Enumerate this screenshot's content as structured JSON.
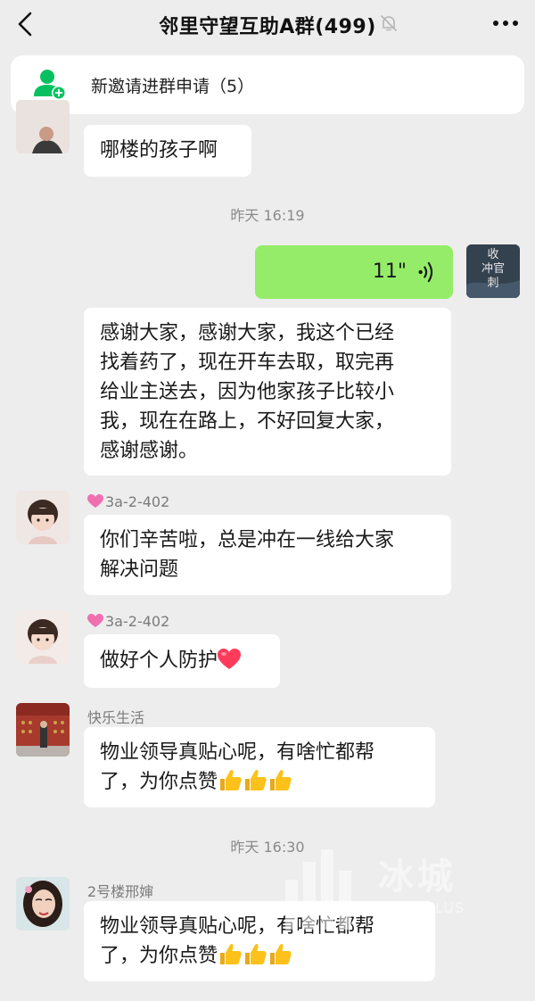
{
  "header": {
    "title": "邻里守望互助A群(499)",
    "back_icon": "chevron-left-icon",
    "mute_icon": "bell-off-icon",
    "more_icon": "more-dots-icon"
  },
  "banner": {
    "text": "新邀请进群申请（5）",
    "icon": "add-user-icon",
    "color": "#07c160"
  },
  "messages": {
    "m0": {
      "text": "哪楼的孩子啊"
    },
    "t1": "昨天 16:19",
    "voice": {
      "duration": "11\"",
      "avatar_text": [
        "收",
        "冲官",
        "刺"
      ]
    },
    "m2": {
      "lines": [
        "感谢大家，感谢大家，我这个已经",
        "找着药了，现在开车去取，取完再",
        "给业主送去，因为他家孩子比较小",
        "我，现在在路上，不好回复大家，",
        "感谢感谢。"
      ]
    },
    "m3": {
      "nick": "3a-2-402",
      "lines": [
        "你们辛苦啦，总是冲在一线给大家",
        "解决问题"
      ]
    },
    "m4": {
      "nick": "3a-2-402",
      "text": "做好个人防护"
    },
    "m5": {
      "nick": "快乐生活",
      "lines": [
        "物业领导真贴心呢，有啥忙都帮",
        "了，为你点赞"
      ]
    },
    "t2": "昨天 16:30",
    "m6": {
      "nick": "2号楼邢婶",
      "lines": [
        "物业领导真贴心呢，有啥忙都帮",
        "了，为你点赞"
      ]
    }
  },
  "watermark": {
    "name": "冰城",
    "sub": "CITY PLUS"
  },
  "colors": {
    "background": "#ededed",
    "bubble_self": "#95ec69",
    "bubble_other": "#ffffff"
  }
}
